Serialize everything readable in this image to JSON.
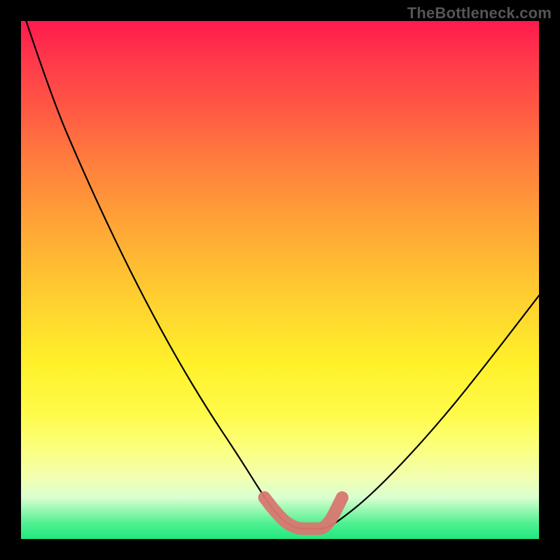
{
  "watermark": "TheBottleneck.com",
  "chart_data": {
    "type": "line",
    "title": "",
    "xlabel": "",
    "ylabel": "",
    "xlim": [
      0,
      100
    ],
    "ylim": [
      0,
      100
    ],
    "grid": false,
    "series": [
      {
        "name": "bottleneck-curve",
        "color": "#000000",
        "x": [
          1,
          6,
          12,
          18,
          24,
          30,
          36,
          42,
          47,
          50,
          53,
          56,
          59,
          62,
          67,
          74,
          82,
          90,
          100
        ],
        "y": [
          100,
          85,
          71,
          58,
          46,
          35,
          25,
          16,
          8,
          4,
          2,
          2,
          2,
          4,
          8,
          15,
          24,
          34,
          47
        ]
      },
      {
        "name": "optimal-band",
        "color": "#d8776f",
        "x": [
          47,
          50,
          53,
          56,
          59,
          62
        ],
        "y": [
          8,
          4,
          2,
          2,
          2,
          8
        ]
      }
    ],
    "annotations": []
  },
  "colors": {
    "background_frame": "#000000",
    "gradient_top": "#ff1a4d",
    "gradient_bottom": "#20e880",
    "curve": "#000000",
    "band_marker": "#d8776f"
  }
}
